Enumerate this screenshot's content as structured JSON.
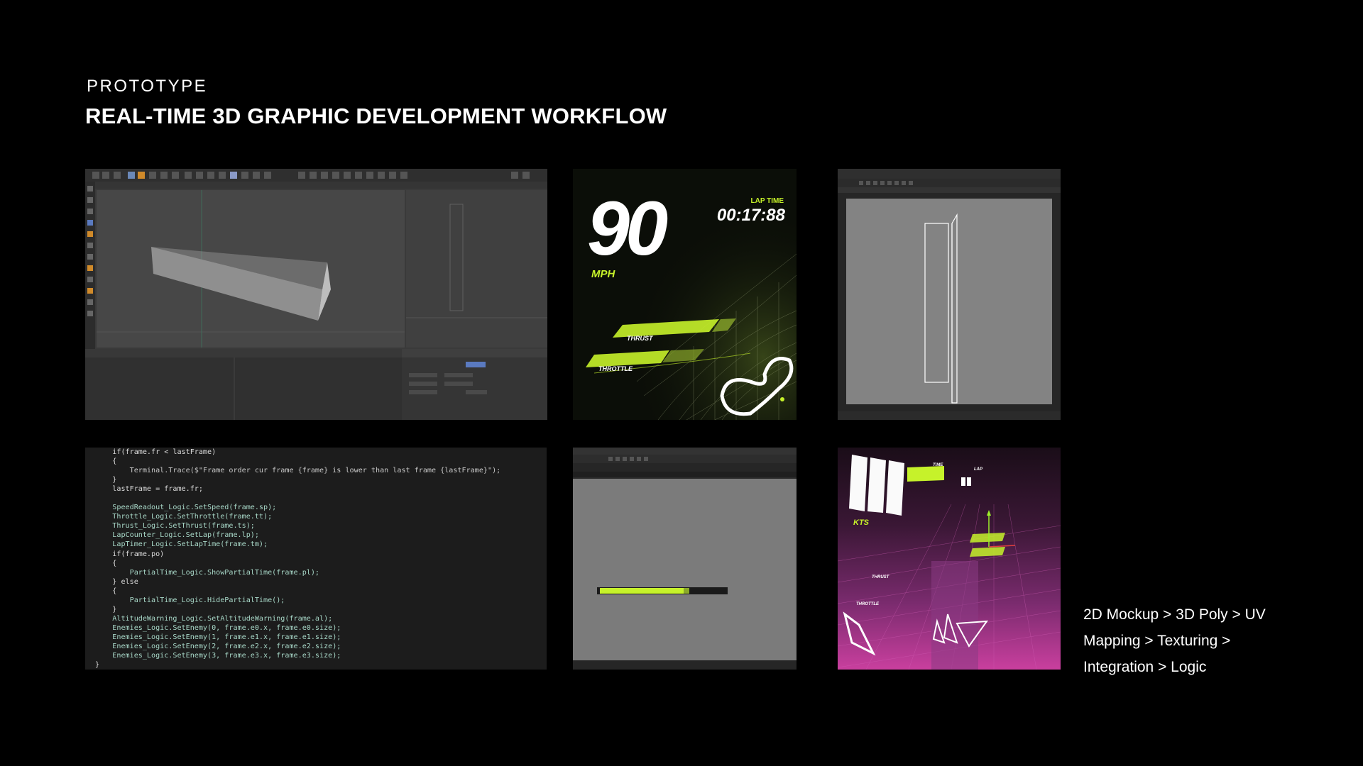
{
  "header": {
    "eyebrow": "PROTOTYPE",
    "title": "REAL-TIME 3D GRAPHIC DEVELOPMENT WORKFLOW"
  },
  "hud": {
    "speed": "90",
    "unit": "MPH",
    "lap_label": "LAP TIME",
    "lap_time": "00:17:88",
    "thrust_label": "THRUST",
    "throttle_label": "THROTTLE"
  },
  "code_lines": [
    "    if(frame.fr < lastFrame)",
    "    {",
    "        Terminal.Trace($\"Frame order cur frame {frame} is lower than last frame {lastFrame}\");",
    "    }",
    "    lastFrame = frame.fr;",
    "",
    "    SpeedReadout_Logic.SetSpeed(frame.sp);",
    "    Throttle_Logic.SetThrottle(frame.tt);",
    "    Thrust_Logic.SetThrust(frame.ts);",
    "    LapCounter_Logic.SetLap(frame.lp);",
    "    LapTimer_Logic.SetLapTime(frame.tm);",
    "    if(frame.po)",
    "    {",
    "        PartialTime_Logic.ShowPartialTime(frame.pl);",
    "    } else",
    "    {",
    "        PartialTime_Logic.HidePartialTime();",
    "    }",
    "    AltitudeWarning_Logic.SetAltitudeWarning(frame.al);",
    "    Enemies_Logic.SetEnemy(0, frame.e0.x, frame.e0.size);",
    "    Enemies_Logic.SetEnemy(1, frame.e1.x, frame.e1.size);",
    "    Enemies_Logic.SetEnemy(2, frame.e2.x, frame.e2.size);",
    "    Enemies_Logic.SetEnemy(3, frame.e3.x, frame.e3.size);",
    "}"
  ],
  "pink_scene": {
    "kts_label": "KTS",
    "time_label": "TIME",
    "lap_label": "LAP",
    "thrust_label": "THRUST",
    "throttle_label": "THROTTLE"
  },
  "caption": {
    "line1": "2D Mockup > 3D Poly > UV",
    "line2": "Mapping > Texturing >",
    "line3": "Integration > Logic"
  },
  "colors": {
    "background": "#000000",
    "accent": "#c6f22a",
    "pink": "#c93f9e"
  }
}
